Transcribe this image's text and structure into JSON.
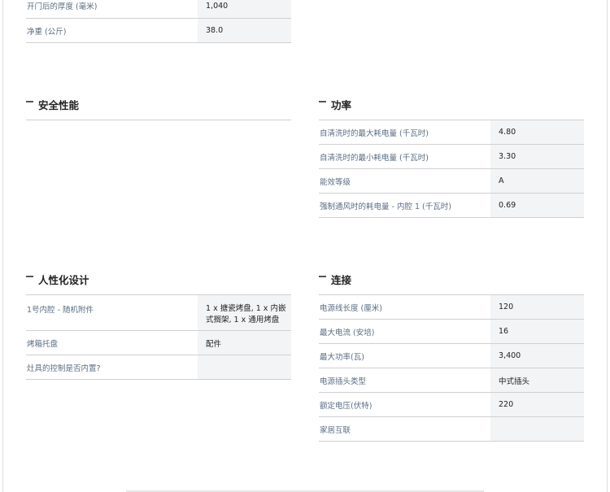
{
  "top_table": {
    "rows": [
      {
        "label": "开门后的厚度 (毫米)",
        "value": "1,040"
      },
      {
        "label": "净重 (公斤)",
        "value": "38.0"
      }
    ]
  },
  "safety": {
    "title": "安全性能"
  },
  "power": {
    "title": "功率",
    "rows": [
      {
        "label": "自清洗时的最大耗电量 (千瓦时)",
        "value": "4.80"
      },
      {
        "label": "自清洗时的最小耗电量 (千瓦时)",
        "value": "3.30"
      },
      {
        "label": "能效等级",
        "value": "A"
      },
      {
        "label": "强制通风时的耗电量 - 内腔 1 (千瓦时)",
        "value": "0.69"
      }
    ]
  },
  "design": {
    "title": "人性化设计",
    "rows": [
      {
        "label": "1号内腔 - 随机附件",
        "value": "1 x 搪瓷烤盘, 1 x 内嵌式搁架, 1 x 通用烤盘"
      },
      {
        "label": "烤箱托盘",
        "value": "配件"
      },
      {
        "label": "灶具的控制是否内置?",
        "value": ""
      }
    ]
  },
  "connection": {
    "title": "连接",
    "rows": [
      {
        "label": "电源线长度 (厘米)",
        "value": "120"
      },
      {
        "label": "最大电流 (安培)",
        "value": "16"
      },
      {
        "label": "最大功率(瓦)",
        "value": "3,400"
      },
      {
        "label": "电源插头类型",
        "value": "中式插头"
      },
      {
        "label": "额定电压(伏特)",
        "value": "220"
      },
      {
        "label": "家居互联",
        "value": ""
      }
    ]
  }
}
